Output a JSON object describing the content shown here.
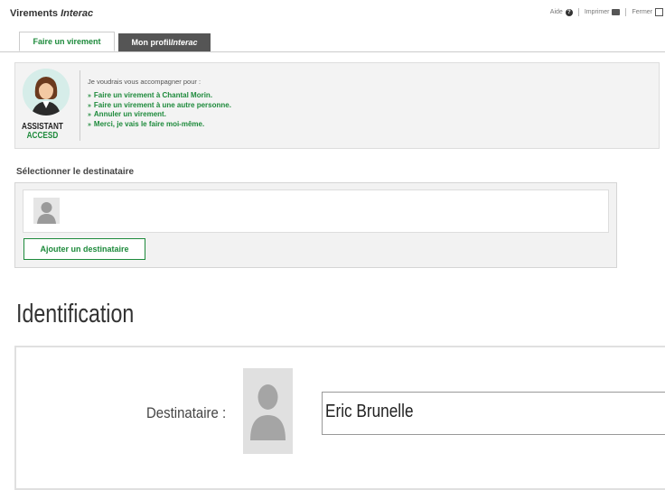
{
  "header": {
    "title_main": "Virements ",
    "title_italic": "Interac",
    "links": {
      "help": "Aide",
      "print": "Imprimer",
      "close": "Fermer"
    }
  },
  "tabs": [
    {
      "label": "Faire un virement",
      "active": true
    },
    {
      "label_main": "Mon profil",
      "label_italic": "Interac",
      "active": false
    }
  ],
  "assistant": {
    "brand_line1": "ASSISTANT",
    "brand_line2": "ACCESD",
    "intro": "Je voudrais vous accompagner pour :",
    "options": [
      "Faire un virement à Chantal Morin.",
      "Faire un virement à une autre personne.",
      "Annuler un virement.",
      "Merci, je vais le faire moi-même."
    ]
  },
  "recipient_selection": {
    "label": "Sélectionner le destinataire",
    "add_button": "Ajouter un destinataire"
  },
  "identification": {
    "heading": "Identification",
    "recipient_label": "Destinataire :",
    "recipient_value": "Eric Brunelle"
  },
  "colors": {
    "accent": "#1d8a3b",
    "tab_inactive_bg": "#555555",
    "panel_bg": "#f3f3f3"
  },
  "icons": {
    "help": "question-circle-icon",
    "print": "printer-icon",
    "close": "close-icon",
    "assistant": "assistant-woman-avatar",
    "recipient_placeholder": "person-silhouette-icon",
    "bullet": "double-arrow-icon"
  }
}
